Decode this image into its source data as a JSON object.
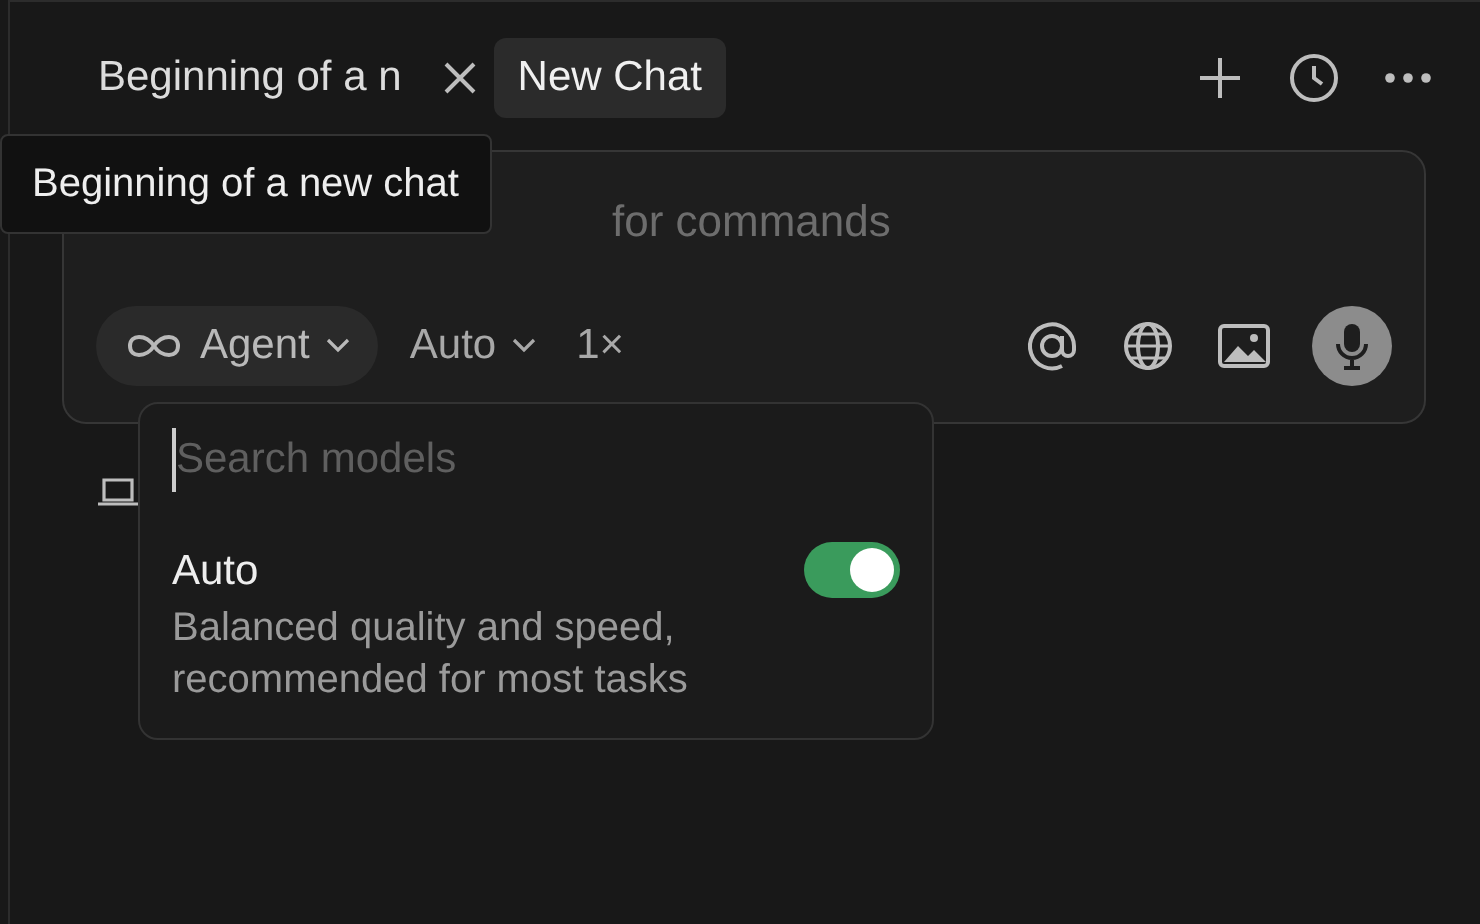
{
  "tabs": [
    {
      "label": "Beginning of a n",
      "selected": false,
      "closable": true
    },
    {
      "label": "New Chat",
      "selected": true,
      "closable": false
    }
  ],
  "tooltip": {
    "text": "Beginning of a new chat"
  },
  "composer": {
    "placeholder": "for commands",
    "mode": {
      "label": "Agent"
    },
    "model": {
      "label": "Auto"
    },
    "multiplier": "1×"
  },
  "model_menu": {
    "search": {
      "placeholder": "Search models"
    },
    "items": [
      {
        "name": "Auto",
        "description": "Balanced quality and speed, recommended for most tasks",
        "on": true
      }
    ]
  }
}
